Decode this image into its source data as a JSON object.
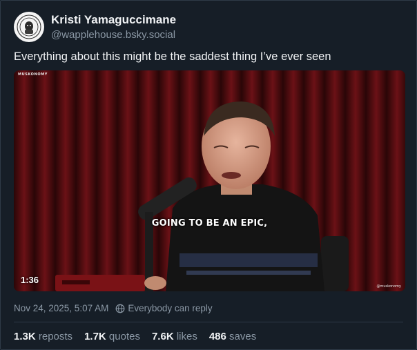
{
  "author": {
    "display_name": "Kristi Yamaguccimane",
    "handle": "@wapplehouse.bsky.social"
  },
  "post": {
    "text": "Everything about this might be the saddest thing I’ve ever seen"
  },
  "video": {
    "subtitle": "GOING TO BE AN EPIC,",
    "duration": "1:36",
    "watermark_top": "MUSKONOMY",
    "watermark_bottom": "@muskonomy"
  },
  "meta": {
    "timestamp": "Nov 24, 2025, 5:07 AM",
    "reply_setting": "Everybody can reply"
  },
  "stats": {
    "reposts_count": "1.3K",
    "reposts_label": "reposts",
    "quotes_count": "1.7K",
    "quotes_label": "quotes",
    "likes_count": "7.6K",
    "likes_label": "likes",
    "saves_count": "486",
    "saves_label": "saves"
  },
  "colors": {
    "background": "#161e27",
    "text_primary": "#f1f3f5",
    "text_secondary": "#8b98a5",
    "border": "#2e3a47"
  },
  "icons": {
    "avatar": "avatar",
    "reply_setting": "globe-icon"
  }
}
